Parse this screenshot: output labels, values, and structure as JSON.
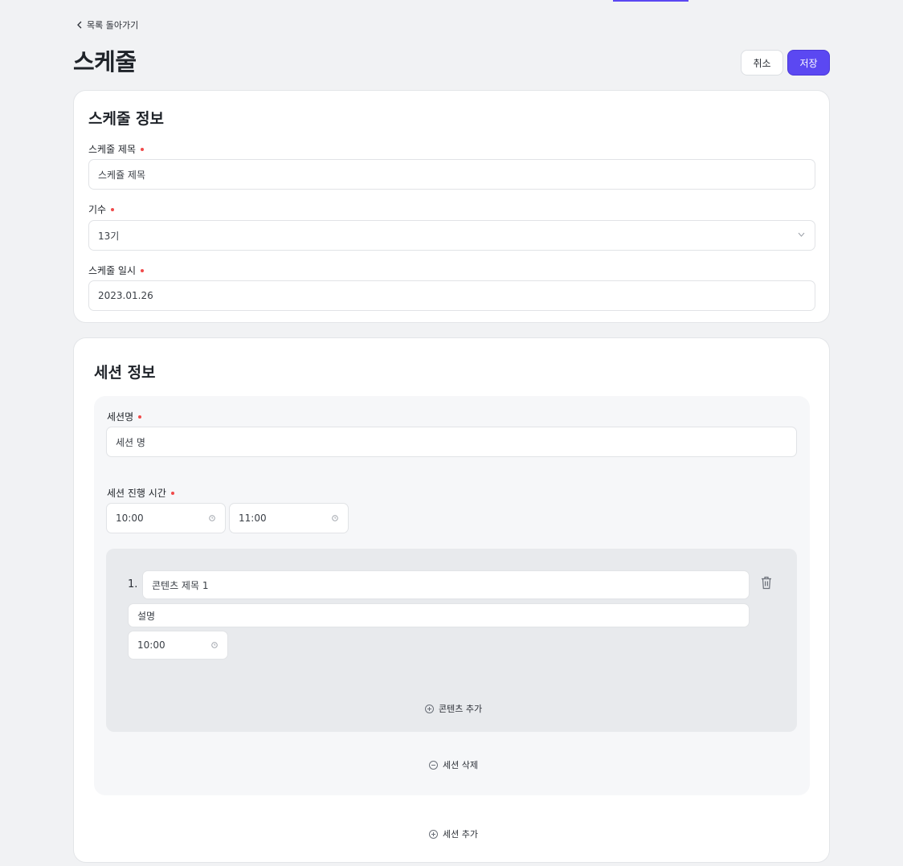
{
  "header": {
    "back_label": "목록 돌아가기",
    "title": "스케줄",
    "cancel_label": "취소",
    "save_label": "저장"
  },
  "schedule_info": {
    "title": "스케줄 정보",
    "name_label": "스케줄 제목",
    "name_value": "스케쥴 제목",
    "generation_label": "기수",
    "generation_value": "13기",
    "date_label": "스케줄 일시",
    "date_value": "2023.01.26"
  },
  "session_info": {
    "title": "세션 정보",
    "session_name_label": "세션명",
    "session_name_value": "세션 명",
    "time_label": "세션 진행 시간",
    "start_time": "10:00",
    "end_time": "11:00",
    "contents": [
      {
        "number": "1.",
        "title": "콘텐츠 제목 1",
        "description": "설명",
        "time": "10:00"
      }
    ],
    "add_content_label": "콘텐츠 추가",
    "delete_session_label": "세션 삭제",
    "add_session_label": "세션 추가"
  },
  "colors": {
    "accent": "#5b48f2",
    "required_dot": "#f04a4a",
    "page_bg": "#f1f2f4"
  }
}
